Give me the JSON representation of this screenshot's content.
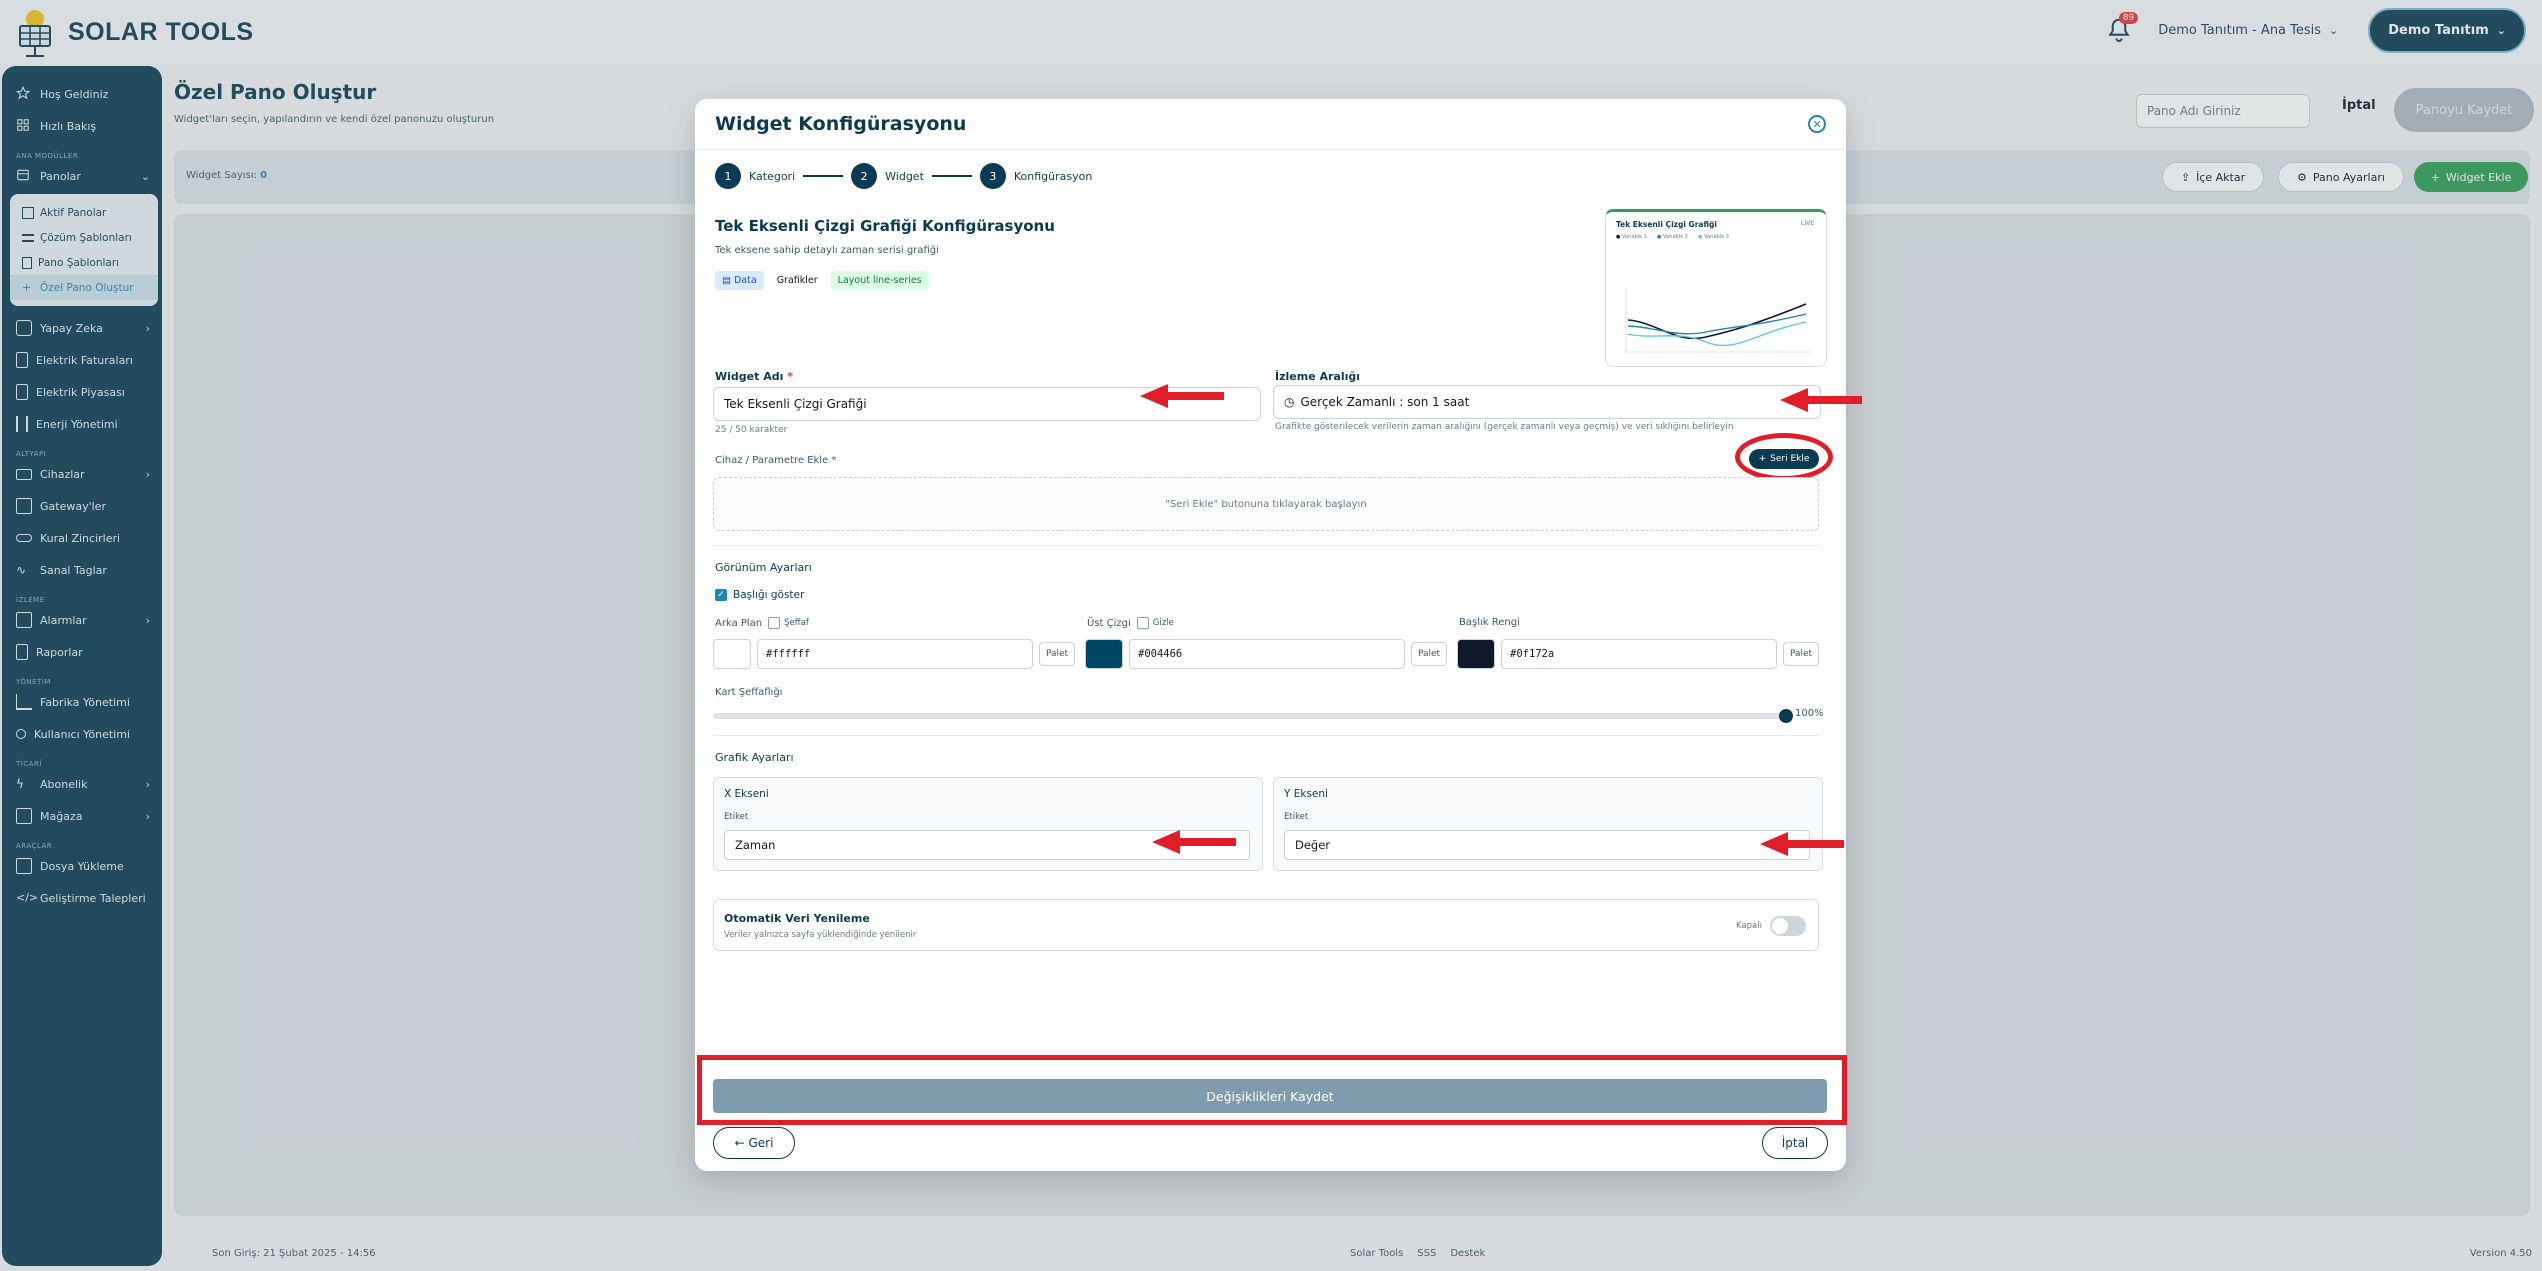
{
  "app": {
    "name": "SOLAR TOOLS"
  },
  "header": {
    "notifications_count": "89",
    "tenant": "Demo Tanıtım - Ana Tesis",
    "user": "Demo Tanıtım"
  },
  "sidebar": {
    "top_items": [
      {
        "label": "Hoş Geldiniz",
        "icon": "star-icon"
      },
      {
        "label": "Hızlı Bakış",
        "icon": "grid-icon"
      }
    ],
    "section_main": "ANA MODÜLLER",
    "panolar": "Panolar",
    "panolar_sub": [
      {
        "label": "Aktif Panolar",
        "icon": "grid-icon"
      },
      {
        "label": "Çözüm Şablonları",
        "icon": "list-icon"
      },
      {
        "label": "Pano Şablonları",
        "icon": "file-icon"
      },
      {
        "label": "Özel Pano Oluştur",
        "icon": "plus-icon"
      }
    ],
    "main_items": [
      {
        "label": "Yapay Zeka",
        "icon": "sparkle-icon",
        "chevron": true
      },
      {
        "label": "Elektrik Faturaları",
        "icon": "receipt-icon",
        "chevron": false
      },
      {
        "label": "Elektrik Piyasası",
        "icon": "receipt-icon",
        "chevron": false
      },
      {
        "label": "Enerji Yönetimi",
        "icon": "sliders-icon",
        "chevron": false
      }
    ],
    "section_altyapi": "ALTYAPI",
    "altyapi_items": [
      {
        "label": "Cihazlar",
        "icon": "monitor-icon",
        "chevron": true
      },
      {
        "label": "Gateway'ler",
        "icon": "server-icon",
        "chevron": false
      },
      {
        "label": "Kural Zincirleri",
        "icon": "link-icon",
        "chevron": false
      },
      {
        "label": "Sanal Taglar",
        "icon": "activity-icon",
        "chevron": false
      }
    ],
    "section_izleme": "İZLEME",
    "izleme_items": [
      {
        "label": "Alarmlar",
        "icon": "alarm-icon",
        "chevron": true
      },
      {
        "label": "Raporlar",
        "icon": "report-icon",
        "chevron": false
      }
    ],
    "section_yonetim": "YÖNETİM",
    "yonetim_items": [
      {
        "label": "Fabrika Yönetimi",
        "icon": "factory-icon",
        "chevron": false
      },
      {
        "label": "Kullanıcı Yönetimi",
        "icon": "users-icon",
        "chevron": false
      }
    ],
    "section_ticari": "TİCARİ",
    "ticari_items": [
      {
        "label": "Abonelik",
        "icon": "bolt-icon",
        "chevron": true
      },
      {
        "label": "Mağaza",
        "icon": "store-icon",
        "chevron": true
      }
    ],
    "section_araclar": "ARAÇLAR",
    "araclar_items": [
      {
        "label": "Dosya Yükleme",
        "icon": "upload-icon",
        "chevron": false
      },
      {
        "label": "Geliştirme Talepleri",
        "icon": "code-icon",
        "chevron": false
      }
    ]
  },
  "page": {
    "title": "Özel Pano Oluştur",
    "subtitle": "Widget'ları seçin, yapılandırın ve kendi özel panonuzu oluşturun",
    "pano_placeholder": "Pano Adı Giriniz",
    "cancel": "İptal",
    "save": "Panoyu Kaydet",
    "widget_count_label": "Widget Sayısı:",
    "widget_count": "0",
    "import": "İçe Aktar",
    "settings": "Pano Ayarları",
    "add_widget": "Widget Ekle"
  },
  "footer": {
    "last_login": "Son Giriş: 21 Şubat 2025 - 14:56",
    "links": [
      "Solar Tools",
      "SSS",
      "Destek"
    ],
    "version": "Version 4.50"
  },
  "modal": {
    "title": "Widget Konfigürasyonu",
    "steps": [
      {
        "num": "1",
        "label": "Kategori"
      },
      {
        "num": "2",
        "label": "Widget"
      },
      {
        "num": "3",
        "label": "Konfigürasyon"
      }
    ],
    "cfg_title": "Tek Eksenli Çizgi Grafiği Konfigürasyonu",
    "cfg_desc": "Tek eksene sahip detaylı zaman serisi grafiği",
    "tags": [
      "Data",
      "Grafikler",
      "Layout line-series"
    ],
    "preview": {
      "title": "Tek Eksenli Çizgi Grafiği",
      "badge": "LIVE",
      "legend": [
        "Variable 1",
        "Variable 2",
        "Variable 3"
      ]
    },
    "widget_name_label": "Widget Adı",
    "widget_name_value": "Tek Eksenli Çizgi Grafiği",
    "widget_name_count": "25 / 50 karakter",
    "range_label": "İzleme Aralığı",
    "range_value": "Gerçek Zamanlı : son 1 saat",
    "range_hint": "Grafikte gösterilecek verilerin zaman aralığını (gerçek zamanlı veya geçmiş) ve veri sıklığını belirleyin",
    "device_label": "Cihaz / Parametre Ekle",
    "seri_btn": "Seri Ekle",
    "dropzone": "\"Seri Ekle\" butonuna tıklayarak başlayın",
    "view_section": "Görünüm Ayarları",
    "show_title": "Başlığı göster",
    "bg_label": "Arka Plan",
    "bg_transparent": "Şeffaf",
    "top_line_label": "Üst Çizgi",
    "top_line_hide": "Gizle",
    "title_color_label": "Başlık Rengi",
    "palette": "Palet",
    "colors": {
      "bg": "#ffffff",
      "top": "#004466",
      "title": "#0f172a"
    },
    "opacity_label": "Kart Şeffaflığı",
    "opacity_value": 100,
    "opacity_text": "100%",
    "graph_section": "Grafik Ayarları",
    "x_axis": "X Ekseni",
    "y_axis": "Y Ekseni",
    "axis_label": "Etiket",
    "x_value": "Zaman",
    "y_value": "Değer",
    "auto_title": "Otomatik Veri Yenileme",
    "auto_sub": "Veriler yalnızca sayfa yüklendiğinde yenilenir",
    "auto_state": "Kapalı",
    "save_changes": "Değişiklikleri Kaydet",
    "back": "← Geri",
    "cancel": "İptal"
  }
}
